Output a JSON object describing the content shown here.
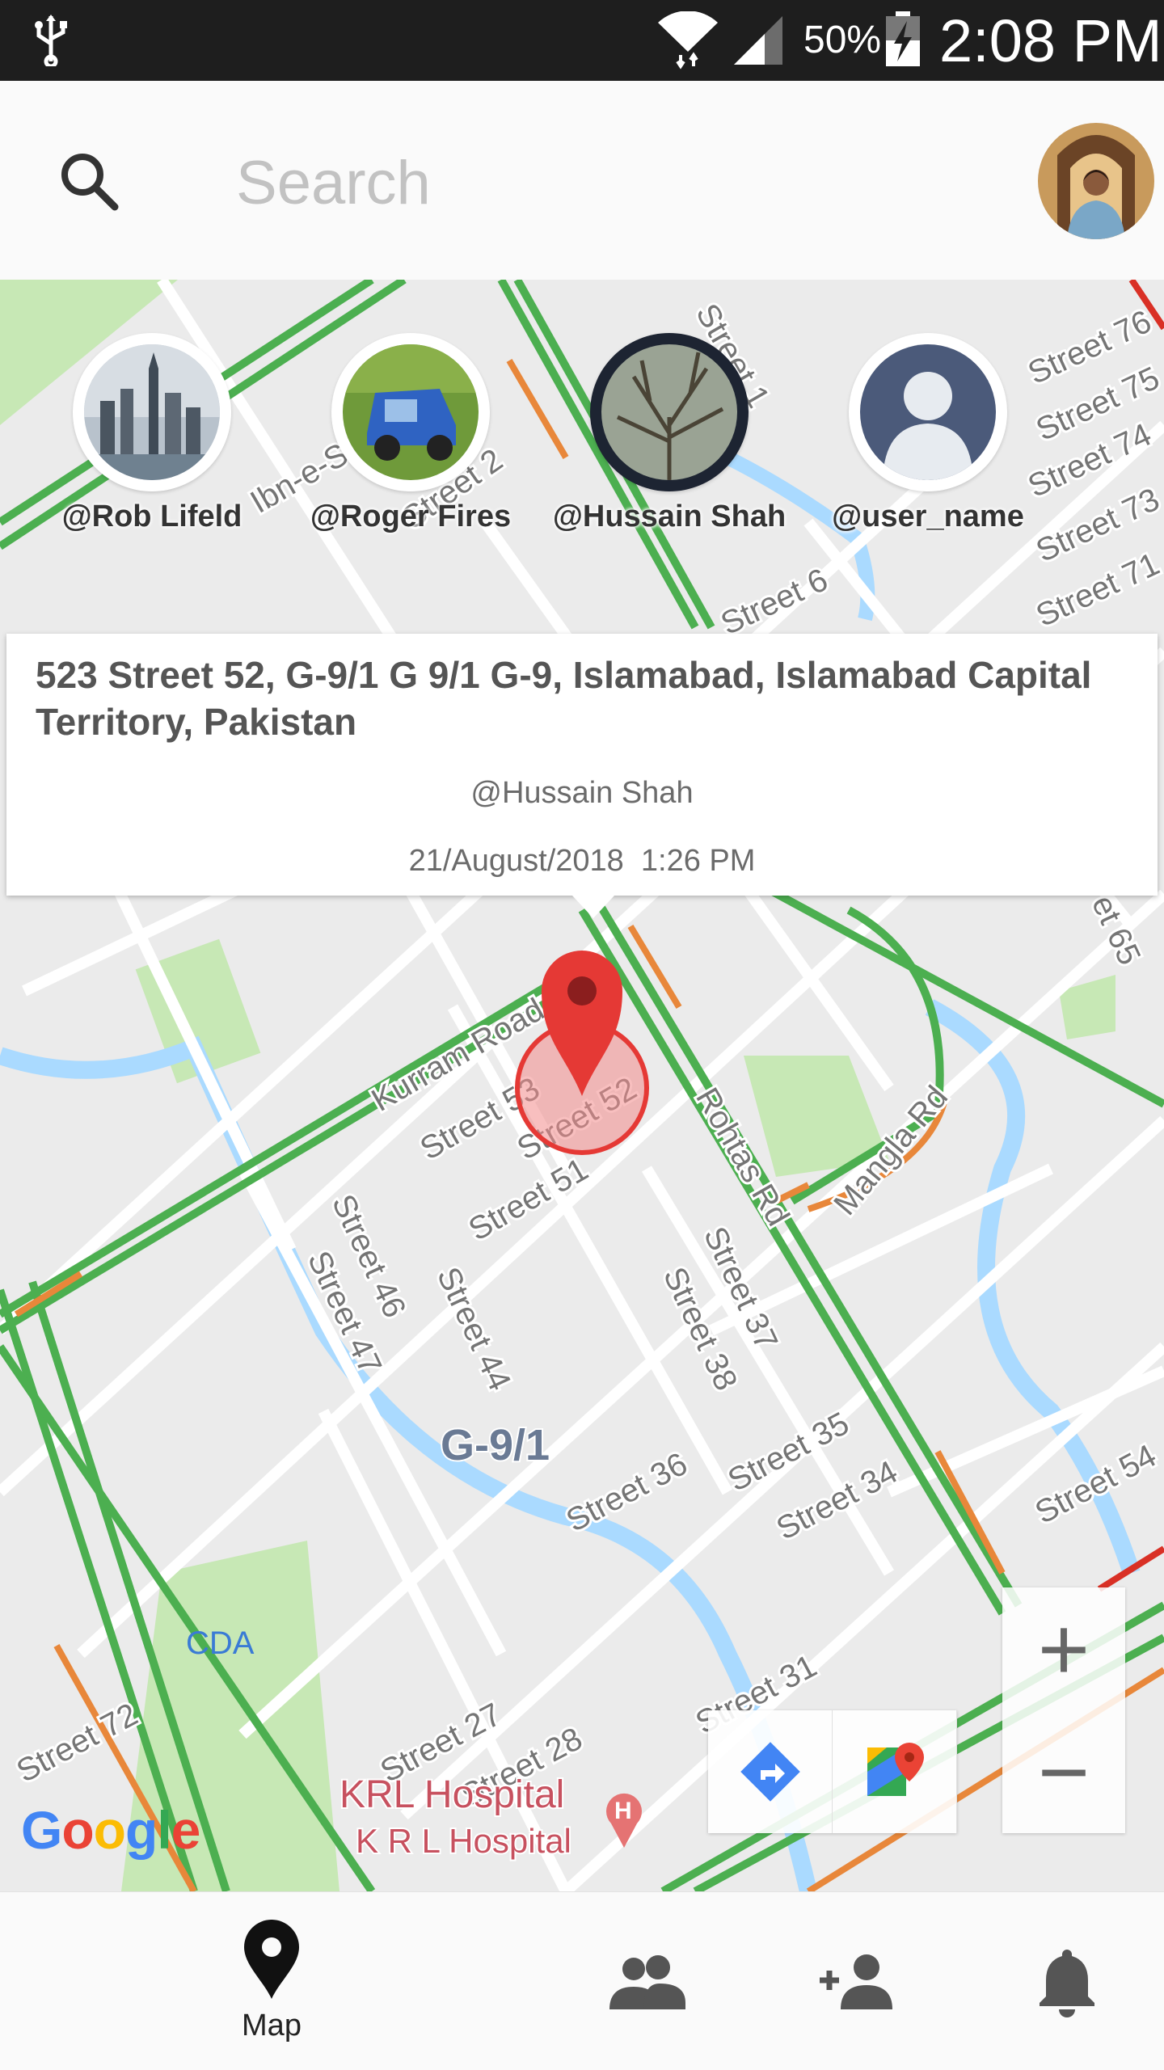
{
  "status_bar": {
    "battery_percent": "50%",
    "clock": "2:08 PM",
    "icons": [
      "usb-icon",
      "wifi-icon",
      "signal-icon",
      "battery-charging-icon"
    ]
  },
  "search": {
    "placeholder": "Search",
    "icon": "search-icon"
  },
  "friends": [
    {
      "name": "@Rob Lifeld",
      "selected": false
    },
    {
      "name": "@Roger Fires",
      "selected": false
    },
    {
      "name": "@Hussain Shah",
      "selected": true
    },
    {
      "name": "@user_name",
      "selected": false
    }
  ],
  "info_window": {
    "address": "523 Street 52, G-9/1 G 9/1 G-9, Islamabad, Islamabad Capital Territory, Pakistan",
    "user": "@Hussain Shah",
    "timestamp": "21/August/2018  1:26 PM"
  },
  "map": {
    "area_label": "G-9/1",
    "streets": [
      "Street 1",
      "Street 2",
      "Street 6",
      "Street 76",
      "Street 75",
      "Street 74",
      "Street 73",
      "Street 71",
      "Ibn-e-S",
      "Kurram Road",
      "Street 53",
      "Street 52",
      "Street 51",
      "Rohtas Rd",
      "Mangla Rd",
      "Street 46",
      "Street 47",
      "Street 44",
      "Street 37",
      "Street 38",
      "Street 35",
      "Street 34",
      "Street 36",
      "Street 54",
      "Street 72",
      "Street 27",
      "Street 28",
      "Street 31",
      "et 65"
    ],
    "places": [
      "CDA",
      "KRL Hospital",
      "K R L Hospital"
    ],
    "attribution": "Google",
    "zoom_in": "+",
    "zoom_out": "−",
    "colors": {
      "road_green": "#4caf50",
      "road_orange": "#e8873a",
      "marker_red": "#e53935",
      "water": "#aadaff",
      "park": "#c7e8b5"
    }
  },
  "bottom_nav": [
    {
      "label": "Map",
      "icon": "map-marker-icon",
      "active": true
    },
    {
      "label": "",
      "icon": "group-icon"
    },
    {
      "label": "",
      "icon": "add-person-icon"
    },
    {
      "label": "",
      "icon": "bell-icon"
    }
  ]
}
